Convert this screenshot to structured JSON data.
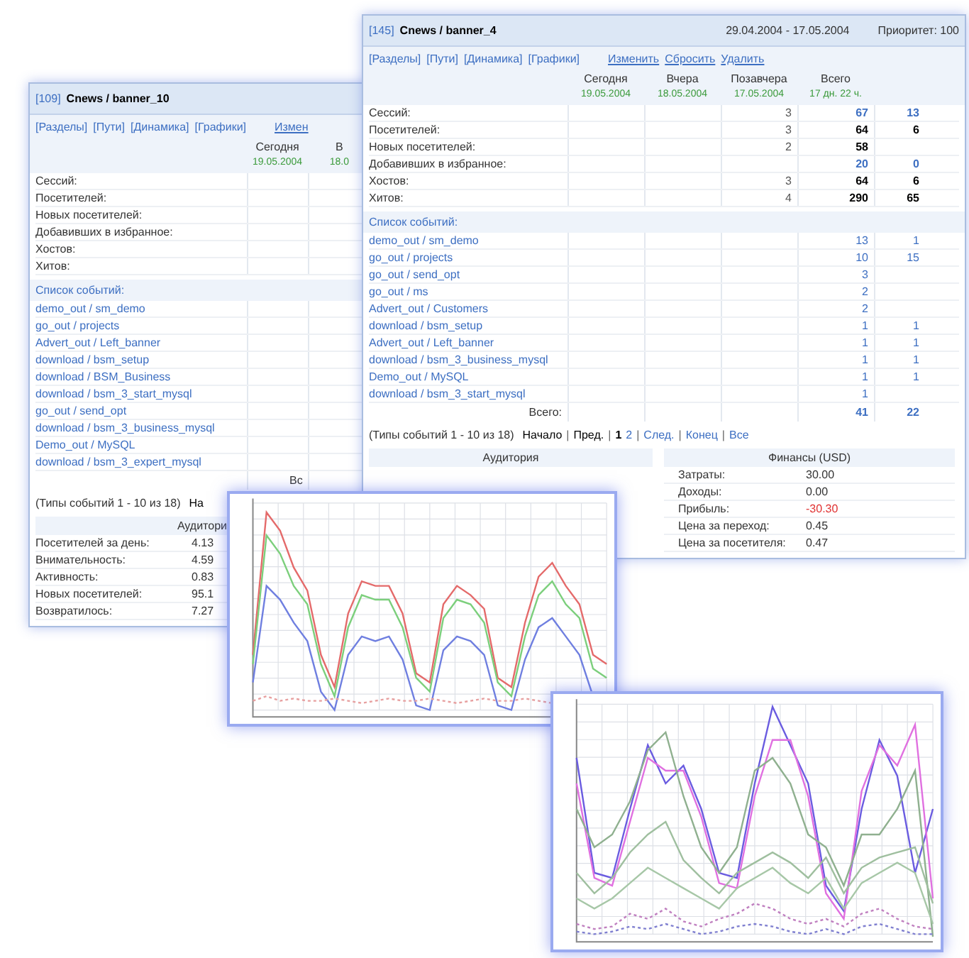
{
  "windows": [
    {
      "kind": "report",
      "id": "[109]",
      "title": "Cnews / banner_10",
      "nav": [
        "[Разделы]",
        "[Пути]",
        "[Динамика]",
        "[Графики]"
      ],
      "actions": [
        "Измен"
      ],
      "columns": [
        {
          "label": "Сегодня",
          "date": "19.05.2004"
        },
        {
          "label": "В",
          "date": "18.0"
        }
      ],
      "stats": [
        {
          "label": "Сессий:"
        },
        {
          "label": "Посетителей:"
        },
        {
          "label": "Новых посетителей:"
        },
        {
          "label": "Добавивших в избранное:"
        },
        {
          "label": "Хостов:"
        },
        {
          "label": "Хитов:"
        }
      ],
      "events_heading": "Список событий:",
      "events": [
        {
          "name": "demo_out / sm_demo"
        },
        {
          "name": "go_out / projects"
        },
        {
          "name": "Advert_out / Left_banner"
        },
        {
          "name": "download / bsm_setup"
        },
        {
          "name": "download / BSM_Business"
        },
        {
          "name": "download / bsm_3_start_mysql"
        },
        {
          "name": "go_out / send_opt"
        },
        {
          "name": "download / bsm_3_business_mysql"
        },
        {
          "name": "Demo_out / MySQL"
        },
        {
          "name": "download / bsm_3_expert_mysql"
        }
      ],
      "total": {
        "label": "Вс"
      },
      "pagination": {
        "summary": "(Типы событий 1 - 10 из 18)",
        "links": [
          {
            "kind": "text",
            "label": "На"
          }
        ]
      },
      "sections": [
        {
          "heading": "Аудитори",
          "rows": [
            {
              "label": "Посетителей за день:",
              "value": "4.13"
            },
            {
              "label": "Внимательность:",
              "value": "4.59"
            },
            {
              "label": "Активность:",
              "value": "0.83"
            },
            {
              "label": "Новых посетителей:",
              "value": "95.1"
            },
            {
              "label": "Возвратилось:",
              "value": "7.27"
            }
          ]
        }
      ]
    },
    {
      "kind": "report",
      "id": "[145]",
      "title": "Cnews / banner_4",
      "period": "29.04.2004 - 17.05.2004",
      "priority": "Приоритет: 100",
      "nav": [
        "[Разделы]",
        "[Пути]",
        "[Динамика]",
        "[Графики]"
      ],
      "actions": [
        "Изменить",
        "Сбросить",
        "Удалить"
      ],
      "columns": [
        {
          "label": "Сегодня",
          "date": "19.05.2004"
        },
        {
          "label": "Вчера",
          "date": "18.05.2004"
        },
        {
          "label": "Позавчера",
          "date": "17.05.2004"
        },
        {
          "label": "Всего",
          "date": "17 дн. 22 ч."
        }
      ],
      "stats": [
        {
          "label": "Сессий:",
          "linked": true,
          "values": {
            "day_before": "3",
            "total": "67",
            "column_5": "13"
          }
        },
        {
          "label": "Посетителей:",
          "linked": false,
          "values": {
            "day_before": "3",
            "total": "64",
            "column_5": "6"
          }
        },
        {
          "label": "Новых посетителей:",
          "linked": false,
          "values": {
            "day_before": "2",
            "total": "58"
          }
        },
        {
          "label": "Добавивших в избранное:",
          "linked": true,
          "values": {
            "total": "20",
            "column_5": "0"
          }
        },
        {
          "label": "Хостов:",
          "linked": false,
          "values": {
            "day_before": "3",
            "total": "64",
            "column_5": "6"
          }
        },
        {
          "label": "Хитов:",
          "linked": false,
          "values": {
            "day_before": "4",
            "total": "290",
            "column_5": "65"
          }
        }
      ],
      "events_heading": "Список событий:",
      "events": [
        {
          "name": "demo_out / sm_demo",
          "values": {
            "total": "13",
            "column_5": "1"
          }
        },
        {
          "name": "go_out / projects",
          "values": {
            "total": "10",
            "column_5": "15"
          }
        },
        {
          "name": "go_out / send_opt",
          "values": {
            "total": "3"
          }
        },
        {
          "name": "go_out / ms",
          "values": {
            "total": "2"
          }
        },
        {
          "name": "Advert_out / Customers",
          "values": {
            "total": "2"
          }
        },
        {
          "name": "download / bsm_setup",
          "values": {
            "total": "1",
            "column_5": "1"
          }
        },
        {
          "name": "Advert_out / Left_banner",
          "values": {
            "total": "1",
            "column_5": "1"
          }
        },
        {
          "name": "download / bsm_3_business_mysql",
          "values": {
            "total": "1",
            "column_5": "1"
          }
        },
        {
          "name": "Demo_out / MySQL",
          "values": {
            "total": "1",
            "column_5": "1"
          }
        },
        {
          "name": "download / bsm_3_start_mysql",
          "values": {
            "total": "1"
          }
        }
      ],
      "total": {
        "label": "Всего:",
        "values": {
          "total": "41",
          "column_5": "22"
        }
      },
      "pagination": {
        "summary": "(Типы событий 1 - 10 из 18)",
        "links": [
          {
            "kind": "text",
            "label": "Начало"
          },
          {
            "kind": "separator",
            "label": "|"
          },
          {
            "kind": "text",
            "label": "Пред."
          },
          {
            "kind": "separator",
            "label": "|"
          },
          {
            "kind": "current",
            "label": "1"
          },
          {
            "kind": "link",
            "label": "2"
          },
          {
            "kind": "separator",
            "label": "|"
          },
          {
            "kind": "link",
            "label": "След."
          },
          {
            "kind": "separator",
            "label": "|"
          },
          {
            "kind": "link",
            "label": "Конец"
          },
          {
            "kind": "separator",
            "label": "|"
          },
          {
            "kind": "link",
            "label": "Все"
          }
        ]
      },
      "sections": [
        {
          "heading": "Аудитория"
        },
        {
          "heading": "Финансы (USD)",
          "rows": [
            {
              "label": "Затраты:",
              "value": "30.00",
              "negative": false
            },
            {
              "label": "Доходы:",
              "value": "0.00",
              "negative": false
            },
            {
              "label": "Прибыль:",
              "value": "-30.30",
              "negative": true
            },
            {
              "label": "Цена за переход:",
              "value": "0.45",
              "negative": false
            },
            {
              "label": "Цена за посетителя:",
              "value": "0.47",
              "negative": false
            }
          ]
        }
      ]
    },
    {
      "kind": "chart"
    },
    {
      "kind": "chart"
    }
  ]
}
